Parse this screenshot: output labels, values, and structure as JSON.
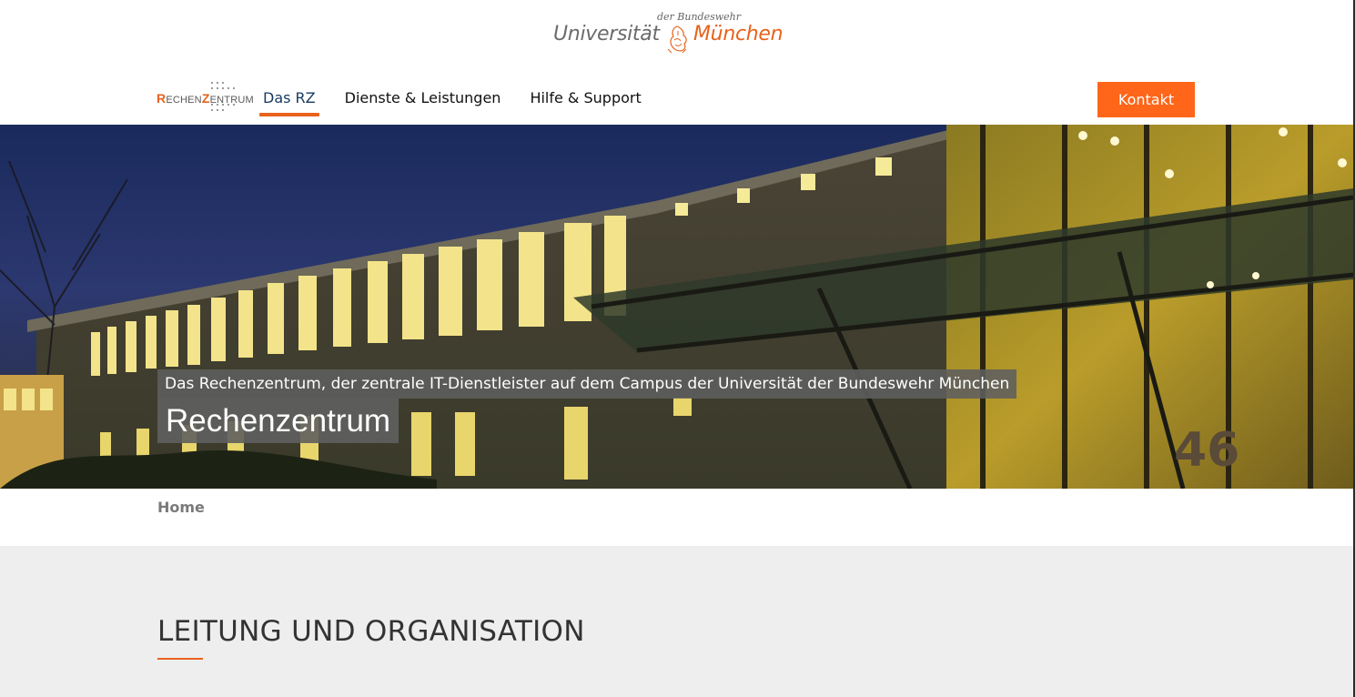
{
  "header": {
    "uni_logo": {
      "line_small": "der Bundeswehr",
      "word_left": "Universität",
      "word_right": "München",
      "seal_icon": "university-seal-icon"
    },
    "rz_logo": {
      "part1_initial": "R",
      "part1_rest": "ECHEN",
      "part2_initial": "Z",
      "part2_rest": "ENTRUM"
    },
    "nav": {
      "items": [
        {
          "label": "Das RZ",
          "active": true
        },
        {
          "label": "Dienste & Leistungen",
          "active": false
        },
        {
          "label": "Hilfe & Support",
          "active": false
        }
      ]
    },
    "kontakt_label": "Kontakt"
  },
  "hero": {
    "subtitle": "Das Rechenzentrum, der zentrale IT-Dienstleister auf dem Campus der Universität der Bundeswehr München",
    "title": "Rechenzentrum",
    "building_number": "46"
  },
  "breadcrumb": {
    "home_label": "Home"
  },
  "section": {
    "heading": "LEITUNG UND ORGANISATION"
  },
  "colors": {
    "accent": "#e8621d",
    "button": "#ff6619",
    "nav_active": "#1a3a63",
    "section_bg": "#eeeeee"
  }
}
